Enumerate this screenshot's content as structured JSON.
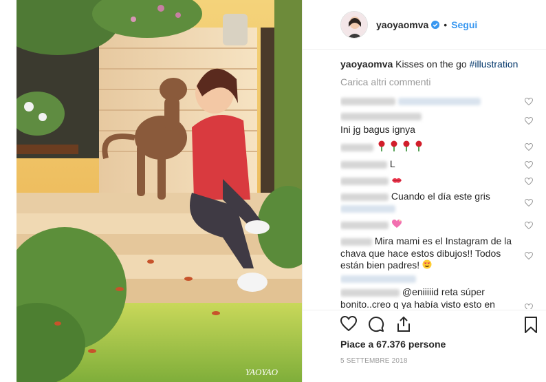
{
  "header": {
    "username": "yaoyaomva",
    "separator": "•",
    "follow_label": "Segui"
  },
  "caption": {
    "username": "yaoyaomva",
    "text": "Kisses on the go",
    "hashtag": "#illustration"
  },
  "load_more_label": "Carica altri commenti",
  "comments": [
    {
      "text": ""
    },
    {
      "text": "Ini jg bagus ignya"
    },
    {
      "text": ""
    },
    {
      "text": "L"
    },
    {
      "text": ""
    },
    {
      "text": "Cuando el día este gris"
    },
    {
      "text": ""
    },
    {
      "text": "Mira mami es el Instagram de la chava que hace estos dibujos!! Todos están bien padres!"
    },
    {
      "text": "@eniiiiid reta súper bonito..creo q ya había visto esto en"
    }
  ],
  "likes": {
    "label": "Piace a 67.376 persone"
  },
  "date": "5 SETTEMBRE 2018",
  "image": {
    "signature": "YAOYAO"
  },
  "icons": {
    "verified": "verified-badge-icon",
    "like": "heart-icon",
    "comment": "comment-bubble-icon",
    "share": "share-icon",
    "save": "bookmark-icon"
  },
  "colors": {
    "link": "#3897f0",
    "hashtag": "#003569",
    "muted": "#999999",
    "border": "#efefef"
  }
}
